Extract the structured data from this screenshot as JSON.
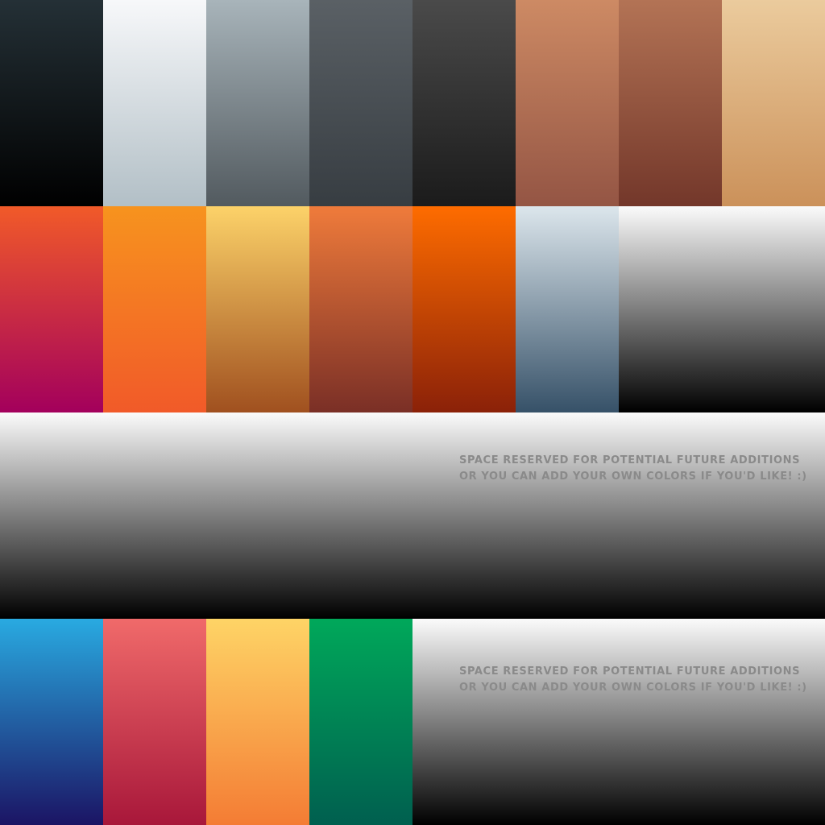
{
  "rows": [
    {
      "swatches": [
        {
          "name": "swatch-charcoal",
          "top": "#243036",
          "bottom": "#000000"
        },
        {
          "name": "swatch-ice-white",
          "top": "#f7f8fa",
          "bottom": "#b2bfc6"
        },
        {
          "name": "swatch-slate-grey",
          "top": "#a8b4ba",
          "bottom": "#525a5f"
        },
        {
          "name": "swatch-gunmetal",
          "top": "#5a6065",
          "bottom": "#373d42"
        },
        {
          "name": "swatch-dark-grey",
          "top": "#4a4a4a",
          "bottom": "#1b1b1b"
        },
        {
          "name": "swatch-terracotta",
          "top": "#cd8a64",
          "bottom": "#945544"
        },
        {
          "name": "swatch-rust-brown",
          "top": "#b37355",
          "bottom": "#73372a"
        },
        {
          "name": "swatch-sand",
          "top": "#ebcb9d",
          "bottom": "#cb915a"
        }
      ]
    },
    {
      "swatches": [
        {
          "name": "swatch-orange-magenta",
          "top": "#f15a29",
          "bottom": "#a3005c"
        },
        {
          "name": "swatch-tangerine",
          "top": "#f7931e",
          "bottom": "#f15a29"
        },
        {
          "name": "swatch-gold-bronze",
          "top": "#fcd269",
          "bottom": "#a0501f"
        },
        {
          "name": "swatch-copper",
          "top": "#ef7b3b",
          "bottom": "#7a2f26"
        },
        {
          "name": "swatch-burnt-orange",
          "top": "#fe6c00",
          "bottom": "#8b2108"
        },
        {
          "name": "swatch-steel-blue",
          "top": "#dce6ec",
          "bottom": "#365168"
        },
        {
          "name": "swatch-reserved-grey",
          "top": "#fbfbfb",
          "bottom": "#000000"
        }
      ]
    },
    {
      "swatches": [
        {
          "name": "swatch-reserved-wide",
          "top": "#fbfbfb",
          "bottom": "#000000"
        }
      ]
    },
    {
      "swatches": [
        {
          "name": "swatch-ocean-blue",
          "top": "#29aae1",
          "bottom": "#1b1464"
        },
        {
          "name": "swatch-crimson",
          "top": "#f06a6a",
          "bottom": "#a8173a"
        },
        {
          "name": "swatch-honey",
          "top": "#fed466",
          "bottom": "#f47c34"
        },
        {
          "name": "swatch-emerald",
          "top": "#00a85a",
          "bottom": "#005f4f"
        },
        {
          "name": "swatch-reserved-bottom",
          "top": "#fbfbfb",
          "bottom": "#000000"
        }
      ]
    }
  ],
  "notes": [
    {
      "line1": "Space reserved for potential future additions",
      "line2": "or you can add your own colors if you'd like! :)"
    },
    {
      "line1": "Space reserved for potential future additions",
      "line2": "or you can add your own colors if you'd like! :)"
    }
  ]
}
